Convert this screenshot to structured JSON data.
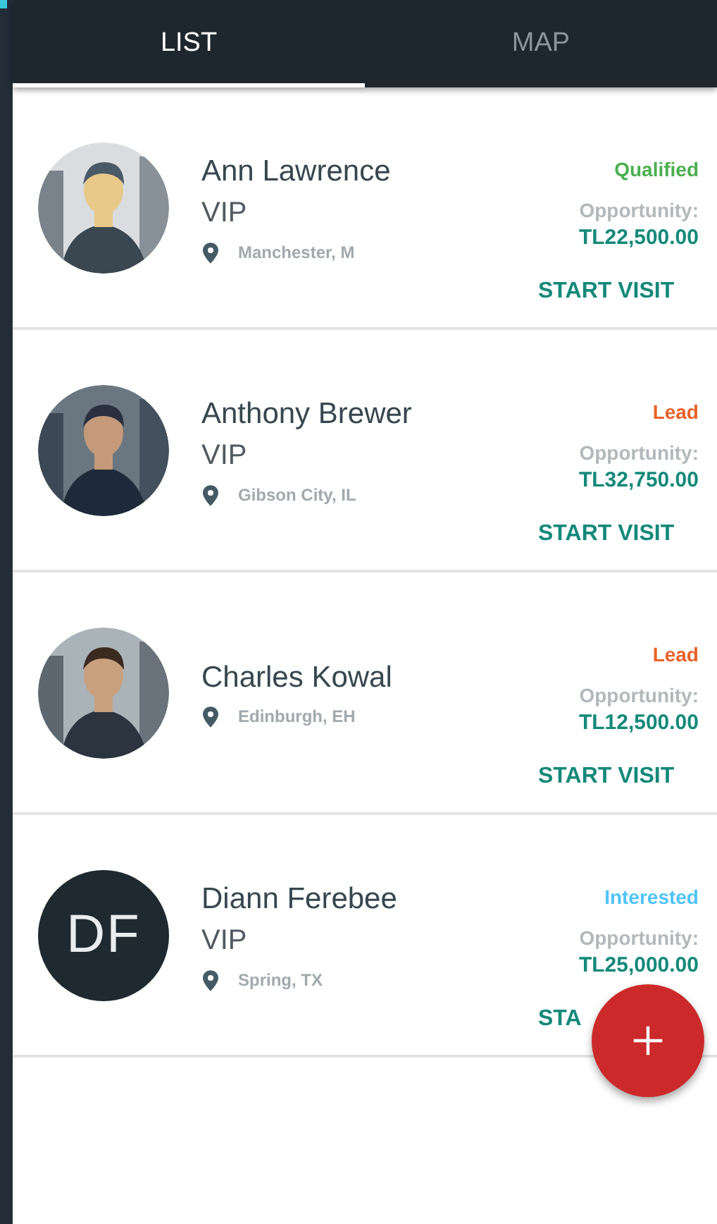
{
  "tabs": [
    {
      "label": "LIST",
      "selected": true
    },
    {
      "label": "MAP",
      "selected": false
    }
  ],
  "contacts": [
    {
      "name": "Ann Lawrence",
      "tier": "VIP",
      "location": "Manchester, M",
      "status": "Qualified",
      "color": "#4caf50",
      "opportunity_label": "Opportunity:",
      "amount": "TL22,500.00",
      "action": "START VISIT"
    },
    {
      "name": "Anthony Brewer",
      "tier": "VIP",
      "location": "Gibson City, IL",
      "status": "Lead",
      "color": "#e8622a",
      "opportunity_label": "Opportunity:",
      "amount": "TL32,750.00",
      "action": "START VISIT"
    },
    {
      "name": "Charles Kowal",
      "location": "Edinburgh, EH",
      "status": "Lead",
      "color": "#e8622a",
      "opportunity_label": "Opportunity:",
      "amount": "TL12,500.00",
      "action": "START VISIT"
    },
    {
      "avatar": {
        "kind": "initials",
        "text": "DF"
      },
      "name": "Diann Ferebee",
      "tier": "VIP",
      "location": "Spring, TX",
      "status": "Interested",
      "color": "#4fc3f7",
      "opportunity_label": "Opportunity:",
      "amount": "TL25,000.00",
      "action": "STA"
    }
  ]
}
